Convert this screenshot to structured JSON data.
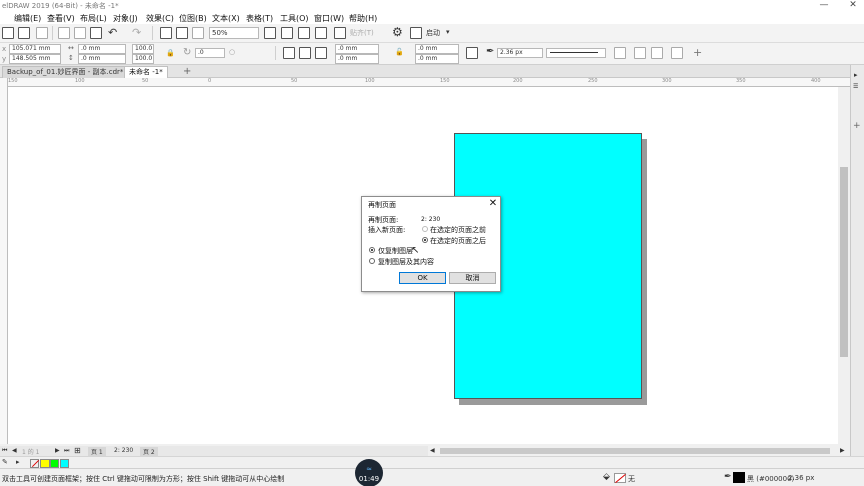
{
  "window": {
    "title": "elDRAW 2019 (64-Bit) - 未命名 -1*",
    "minimize": "—",
    "close": "✕"
  },
  "menu": [
    "编辑(E)",
    "查看(V)",
    "布局(L)",
    "对象(J)",
    "效果(C)",
    "位图(B)",
    "文本(X)",
    "表格(T)",
    "工具(O)",
    "窗口(W)",
    "帮助(H)"
  ],
  "toolbar": {
    "zoom": "50%",
    "launch_label": "启动",
    "snap_label": "贴齐(T)"
  },
  "property_bar": {
    "x": "105.071 mm",
    "y": "148.505 mm",
    "w": ".0 mm",
    "h": ".0 mm",
    "scale_w": "100.0",
    "scale_h": "100.0",
    "angle": ".0",
    "corner_1": ".0 mm",
    "corner_2": ".0 mm",
    "corner_3": ".0 mm",
    "corner_4": ".0 mm",
    "outline_width": "2.36 px"
  },
  "tabs": [
    {
      "label": "Backup_of_01.妙匠界面 - 副本.cdr*",
      "active": false
    },
    {
      "label": "未命名 -1*",
      "active": true
    }
  ],
  "ruler": {
    "h_ticks": [
      "150",
      "100",
      "50",
      "0",
      "50",
      "100",
      "150",
      "200",
      "250",
      "300",
      "350",
      "400"
    ]
  },
  "page_nav": {
    "info": "1 的 1",
    "page_tab_1": "页 1",
    "current": "2: 230",
    "page_tab_2": "页 2"
  },
  "colors": {
    "page_fill": "#00ffff",
    "swatches": [
      "#ffffff",
      "#ffff00",
      "#00ff00",
      "#00ffff"
    ]
  },
  "status": {
    "hint": "双击工具可创建页面框架；按住 Ctrl 键拖动可限制为方形；按住 Shift 键拖动可从中心绘制",
    "fill_label": "无",
    "outline_color": "黑 (#000000)",
    "outline_width": "2.36 px",
    "timer": "01:49"
  },
  "dialog": {
    "title": "再制页面",
    "pages_label": "再制页面:",
    "pages_value": "2: 230",
    "insert_label": "插入新页面:",
    "before_label": "在选定的页面之前",
    "after_label": "在选定的页面之后",
    "layer_only_label": "仅复制图层",
    "layer_content_label": "复制图层及其内容",
    "ok_label": "OK",
    "cancel_label": "取消"
  }
}
